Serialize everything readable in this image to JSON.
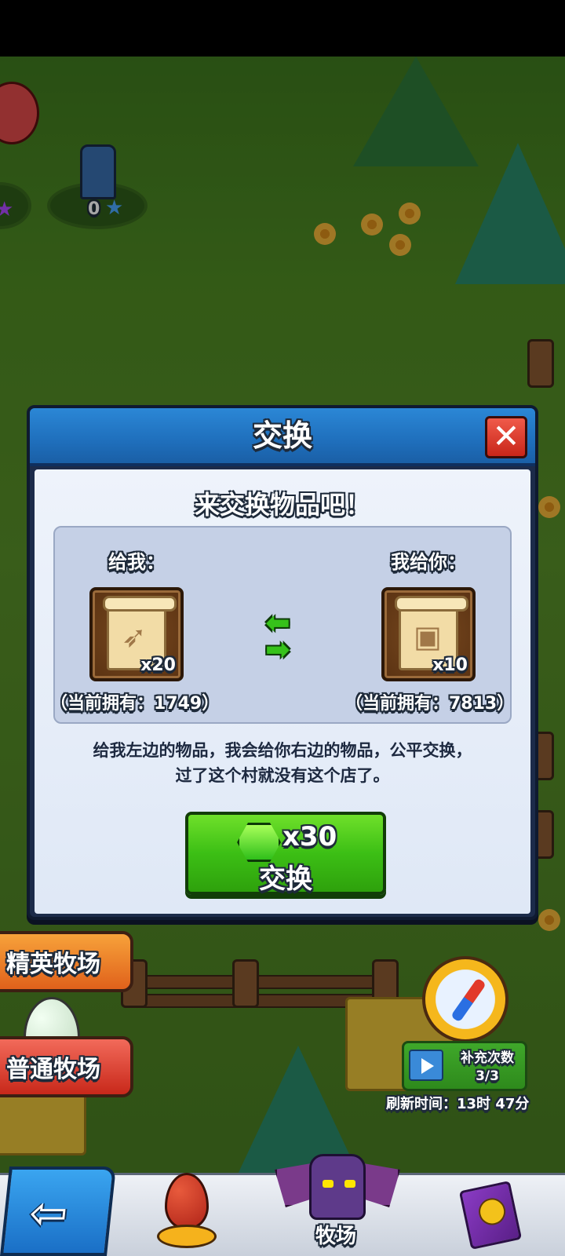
{
  "scene": {
    "scarecrow_stars": "0",
    "left_stars": "☆",
    "elite_ranch_label": "精英牧场",
    "normal_ranch_label": "普通牧场",
    "refill": {
      "label": "补充次数",
      "count": "3/3",
      "refresh_time": "刷新时间：13时 47分"
    }
  },
  "bottom_nav": {
    "back_arrow": "⇦",
    "ranch_label": "牧场"
  },
  "dialog": {
    "title": "交换",
    "close_icon": "✕",
    "subtitle": "来交换物品吧！",
    "give_label": "给我：",
    "receive_label": "我给你：",
    "give_item": {
      "icon": "bow-scroll-icon",
      "glyph": "➶",
      "quantity": "x20",
      "owned": "（当前拥有：1749）"
    },
    "receive_item": {
      "icon": "book-scroll-icon",
      "glyph": "▣",
      "quantity": "x10",
      "owned": "（当前拥有：7813）"
    },
    "description_line1": "给我左边的物品，我会给你右边的物品，公平交换，",
    "description_line2": "过了这个村就没有这个店了。",
    "exchange_button": {
      "gem_quantity": "x30",
      "label": "交换"
    }
  },
  "colors": {
    "header_blue": "#1f6fbc",
    "button_green": "#3cbf15",
    "close_red": "#d6301f",
    "item_brown": "#6a3d18"
  }
}
